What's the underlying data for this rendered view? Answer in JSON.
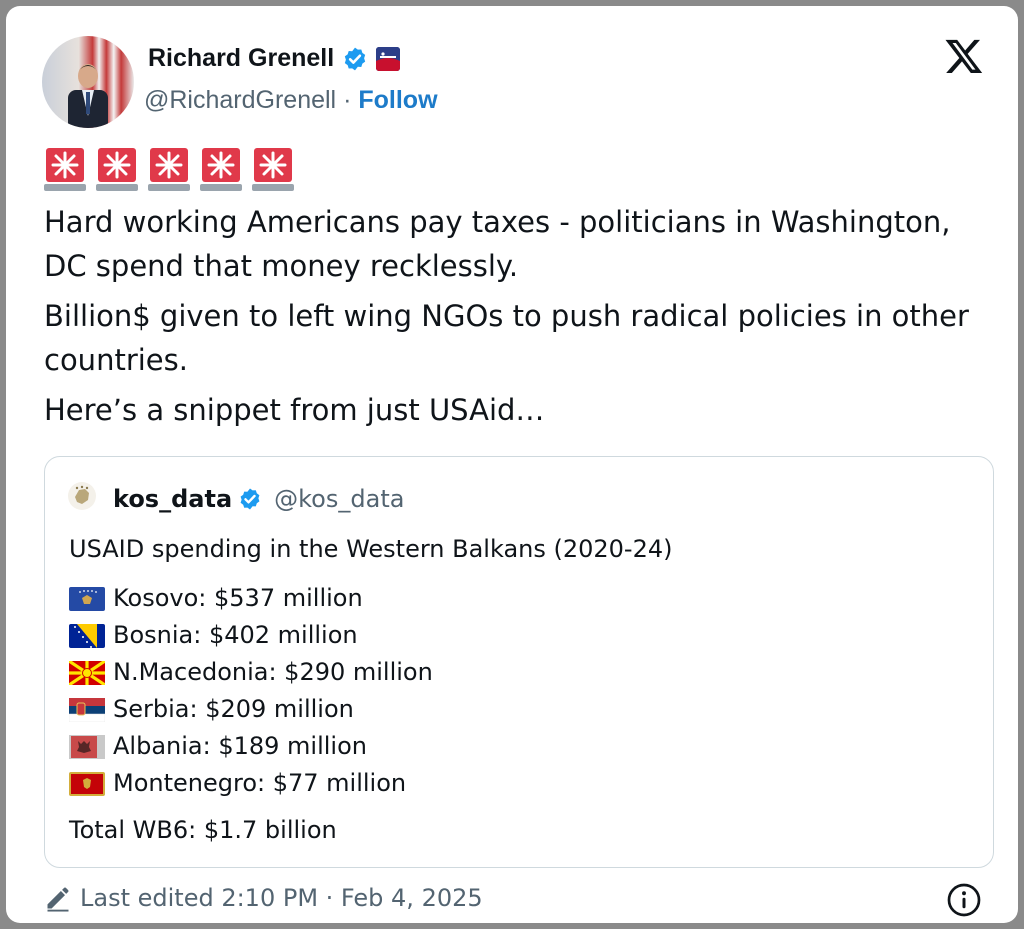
{
  "author": {
    "name": "Richard Grenell",
    "handle": "@RichardGrenell",
    "separator": "·",
    "follow_label": "Follow"
  },
  "tweet": {
    "emoji_row": "🚨🚨🚨🚨🚨",
    "paragraphs": [
      "Hard working Americans pay taxes - politicians in Washington, DC spend that money recklessly.",
      "Billion$ given to left wing NGOs to push radical policies in other countries.",
      "Here’s a snippet from just USAid…"
    ]
  },
  "quote": {
    "name": "kos_data",
    "handle": "@kos_data",
    "title": "USAID spending in the Western Balkans (2020-24)",
    "items": [
      {
        "country": "Kosovo: $537 million",
        "flag": "kosovo-flag"
      },
      {
        "country": "Bosnia: $402 million",
        "flag": "bosnia-flag"
      },
      {
        "country": "N.Macedonia: $290 million",
        "flag": "north-macedonia-flag"
      },
      {
        "country": "Serbia: $209 million",
        "flag": "serbia-flag"
      },
      {
        "country": "Albania: $189 million",
        "flag": "albania-flag"
      },
      {
        "country": "Montenegro: $77 million",
        "flag": "montenegro-flag"
      }
    ],
    "total": "Total WB6: $1.7 billion"
  },
  "footer": {
    "edited": "Last edited 2:10 PM · Feb 4, 2025"
  },
  "colors": {
    "follow": "#1d7bc9",
    "verified": "#1d9bf0",
    "secondary_text": "#536471"
  }
}
